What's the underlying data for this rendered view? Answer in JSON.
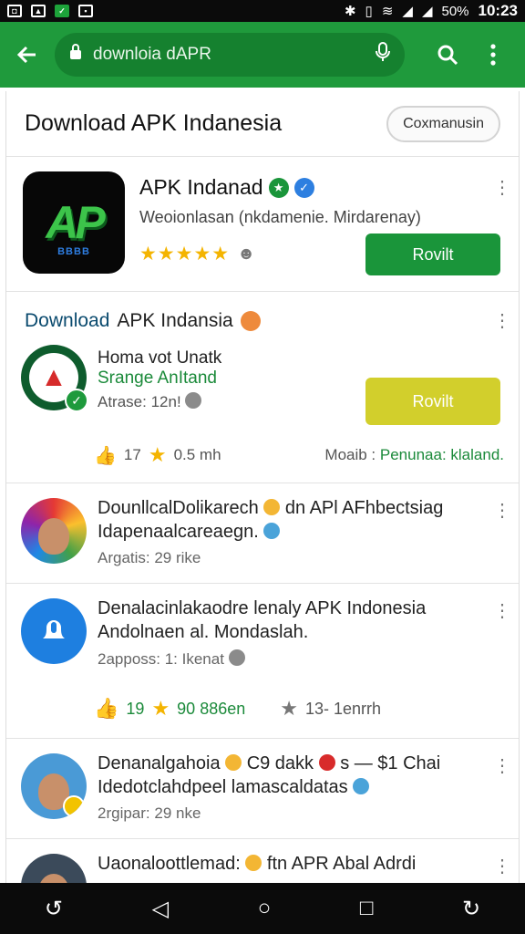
{
  "status": {
    "time": "10:23",
    "battery": "50%",
    "icons": [
      "photo-icon",
      "image-icon",
      "check-icon",
      "mail-icon"
    ]
  },
  "appbar": {
    "url": "downloia dAPR"
  },
  "page": {
    "title": "Download APK Indanesia",
    "pill_label": "Coxmanusin"
  },
  "app_card": {
    "logo_text": "AP",
    "logo_sub": "BBBB",
    "name": "APK Indanad",
    "subtitle": "Weoionlasan (nkdamenie. Mirdarenay)",
    "stars": "★★★★★",
    "button": "Rovilt"
  },
  "feature": {
    "title_a": "Download",
    "title_b": "APK Indansia",
    "line1": "Homa vot Unatk",
    "line2": "Srange AnItand",
    "line3": "Atrase: 12n!",
    "button": "Rovilt",
    "likes": "17",
    "size": "0.5 mh",
    "meta_label": "Moaib :",
    "meta_value": "Penunaa: klaland."
  },
  "rows": [
    {
      "line1": "DounllcalDolikarech",
      "line1b": "dn APl AFhbectsiag",
      "line2": "Idapenaalcareaegn.",
      "line3": "Argatis: 29 rike"
    },
    {
      "line1": "Denalacinlakaodre lenaly APK Indonesia",
      "line2": "Andolnaen al. Mondaslah.",
      "line3": "2apposs: 1: Ikenat",
      "likes": "19",
      "rating": "90 886en",
      "stat": "13- 1enrrh"
    },
    {
      "line1": "Denanalgahoia",
      "line1b": "C9 dakk",
      "line1c": "s — $1 Chai",
      "line2": "Idedotclahdpeel lamascaldatas",
      "line3": "2rgipar: 29 nke"
    },
    {
      "line1": "Uaonaloottlemad:",
      "line1b": "ftn APR Abal Adrdi"
    }
  ]
}
